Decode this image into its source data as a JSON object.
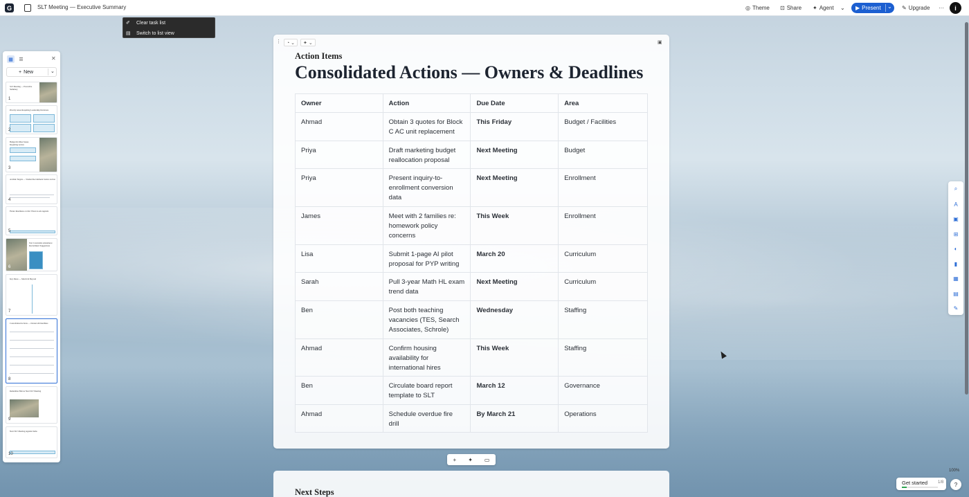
{
  "app": {
    "logo_letter": "G",
    "doc_title": "SLT Meeting — Executive Summary"
  },
  "topbar": {
    "theme": "Theme",
    "share": "Share",
    "agent": "Agent",
    "present": "Present",
    "upgrade": "Upgrade",
    "more": "···",
    "avatar": "i"
  },
  "context_menu": {
    "items": [
      "Clear task list",
      "Switch to list view"
    ]
  },
  "left_panel": {
    "new_label": "New",
    "slides": [
      {
        "num": "1",
        "title": "SLT Meeting — Executive Summary"
      },
      {
        "num": "2",
        "title": "Priority Areas Requiring Leadership Decisions"
      },
      {
        "num": "3",
        "title": "Budget & Other Issues Requiring Action"
      },
      {
        "num": "4",
        "title": "At-Risk Targets — Student Recruitment Justice Action"
      },
      {
        "num": "5",
        "title": "Future Readiness on Our Vision Goals Agenda"
      },
      {
        "num": "6",
        "title": "Test Constraints Attendance Recruitment Suggestions"
      },
      {
        "num": "7",
        "title": "Key Dates — March & Beyond"
      },
      {
        "num": "8",
        "title": "Consolidated Actions — Owners & Deadlines"
      },
      {
        "num": "9",
        "title": "Remember Before Next SLT Meeting"
      },
      {
        "num": "10",
        "title": "Next SLT Meeting Agenda Items"
      }
    ]
  },
  "card": {
    "eyebrow": "Action Items",
    "heading": "Consolidated Actions — Owners & Deadlines",
    "table": {
      "headers": [
        "Owner",
        "Action",
        "Due Date",
        "Area"
      ],
      "rows": [
        [
          "Ahmad",
          "Obtain 3 quotes for Block C AC unit replacement",
          "This Friday",
          "Budget / Facilities"
        ],
        [
          "Priya",
          "Draft marketing budget reallocation proposal",
          "Next Meeting",
          "Budget"
        ],
        [
          "Priya",
          "Present inquiry-to-enrollment conversion data",
          "Next Meeting",
          "Enrollment"
        ],
        [
          "James",
          "Meet with 2 families re: homework policy concerns",
          "This Week",
          "Enrollment"
        ],
        [
          "Lisa",
          "Submit 1-page AI pilot proposal for PYP writing",
          "March 20",
          "Curriculum"
        ],
        [
          "Sarah",
          "Pull 3-year Math HL exam trend data",
          "Next Meeting",
          "Curriculum"
        ],
        [
          "Ben",
          "Post both teaching vacancies (TES, Search Associates, Schrole)",
          "Wednesday",
          "Staffing"
        ],
        [
          "Ahmad",
          "Confirm housing availability for international hires",
          "This Week",
          "Staffing"
        ],
        [
          "Ben",
          "Circulate board report template to SLT",
          "March 12",
          "Governance"
        ],
        [
          "Ahmad",
          "Schedule overdue fire drill",
          "By March 21",
          "Operations"
        ]
      ]
    }
  },
  "next_card": {
    "title": "Next Steps"
  },
  "status": {
    "zoom": "100%",
    "get_started": "Get started",
    "get_started_count": "1/8",
    "get_started_progress": 0.125,
    "help": "?"
  },
  "colors": {
    "accent": "#1c5fd1",
    "progress": "#2ea44f"
  }
}
